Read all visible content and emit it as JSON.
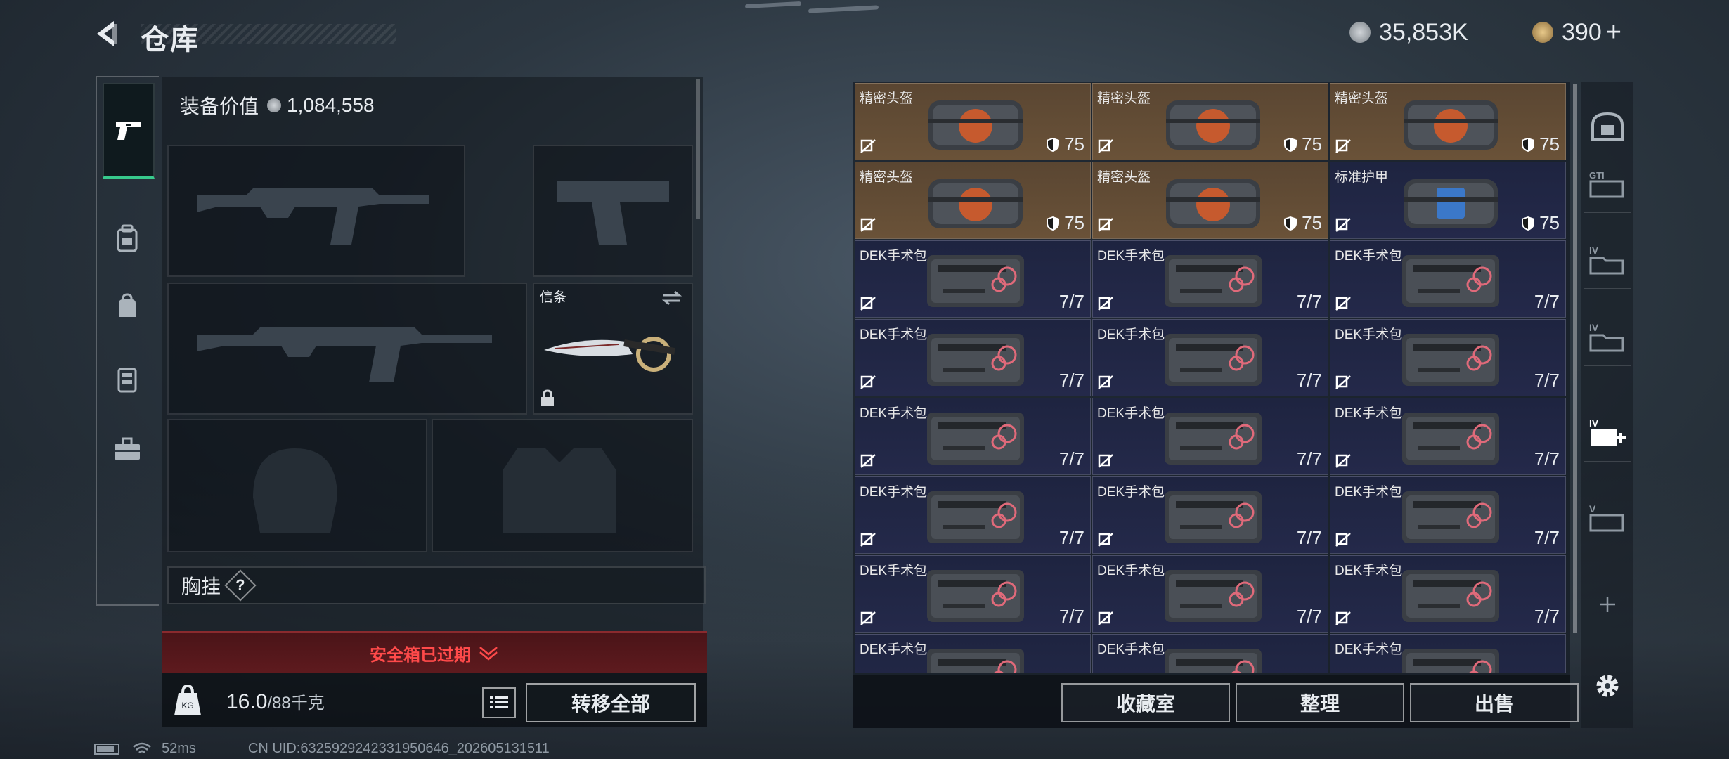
{
  "header": {
    "title": "仓库",
    "currency_silver": "35,853K",
    "currency_gold": "390",
    "plus": "+"
  },
  "left_rail": {
    "items": [
      "weapon-icon",
      "backpack-icon",
      "bag-icon",
      "vest-icon",
      "briefcase-icon"
    ]
  },
  "equipment": {
    "value_label": "装备价值",
    "value": "1,084,558",
    "melee_slot_label": "信条",
    "chest_label": "胸挂",
    "chest_hint": "?",
    "expired_text": "安全箱已过期",
    "weight_current": "16.0",
    "weight_max": "/88千克",
    "transfer_all": "转移全部"
  },
  "grid": {
    "cells": [
      {
        "name": "精密头盔",
        "value": "75",
        "bg": "brown",
        "item": "helmet"
      },
      {
        "name": "精密头盔",
        "value": "75",
        "bg": "brown",
        "item": "helmet"
      },
      {
        "name": "精密头盔",
        "value": "75",
        "bg": "brown",
        "item": "helmet"
      },
      {
        "name": "精密头盔",
        "value": "75",
        "bg": "brown",
        "item": "helmet"
      },
      {
        "name": "精密头盔",
        "value": "75",
        "bg": "brown",
        "item": "helmet"
      },
      {
        "name": "标准护甲",
        "value": "75",
        "bg": "navy",
        "item": "armor"
      },
      {
        "name": "DEK手术包",
        "value": "7/7",
        "bg": "navy",
        "item": "kit"
      },
      {
        "name": "DEK手术包",
        "value": "7/7",
        "bg": "navy",
        "item": "kit"
      },
      {
        "name": "DEK手术包",
        "value": "7/7",
        "bg": "navy",
        "item": "kit"
      },
      {
        "name": "DEK手术包",
        "value": "7/7",
        "bg": "navy",
        "item": "kit"
      },
      {
        "name": "DEK手术包",
        "value": "7/7",
        "bg": "navy",
        "item": "kit"
      },
      {
        "name": "DEK手术包",
        "value": "7/7",
        "bg": "navy",
        "item": "kit"
      },
      {
        "name": "DEK手术包",
        "value": "7/7",
        "bg": "navy",
        "item": "kit"
      },
      {
        "name": "DEK手术包",
        "value": "7/7",
        "bg": "navy",
        "item": "kit"
      },
      {
        "name": "DEK手术包",
        "value": "7/7",
        "bg": "navy",
        "item": "kit"
      },
      {
        "name": "DEK手术包",
        "value": "7/7",
        "bg": "navy",
        "item": "kit"
      },
      {
        "name": "DEK手术包",
        "value": "7/7",
        "bg": "navy",
        "item": "kit"
      },
      {
        "name": "DEK手术包",
        "value": "7/7",
        "bg": "navy",
        "item": "kit"
      },
      {
        "name": "DEK手术包",
        "value": "7/7",
        "bg": "navy",
        "item": "kit"
      },
      {
        "name": "DEK手术包",
        "value": "7/7",
        "bg": "navy",
        "item": "kit"
      },
      {
        "name": "DEK手术包",
        "value": "7/7",
        "bg": "navy",
        "item": "kit"
      },
      {
        "name": "DEK手术包",
        "value": "",
        "bg": "navy",
        "item": "kit"
      },
      {
        "name": "DEK手术包",
        "value": "",
        "bg": "navy",
        "item": "kit"
      },
      {
        "name": "DEK手术包",
        "value": "",
        "bg": "navy",
        "item": "kit"
      }
    ],
    "buttons": {
      "collection": "收藏室",
      "organize": "整理",
      "sell": "出售"
    }
  },
  "right_rail": {
    "tabs": [
      "safe-icon",
      "gti-case-icon",
      "iv-folder-icon",
      "iv-folder-2-icon",
      "iv-medkit-icon",
      "v-case-icon",
      "add-icon",
      "settings-icon"
    ]
  },
  "status": {
    "ping": "52ms",
    "uid": "CN UID:6325929242331950646_202605131511"
  },
  "colors": {
    "accent_green": "#37c98c",
    "danger_red": "#ff4a4a",
    "helmet_bg": "#5a4632",
    "armor_bg": "#24294a"
  }
}
